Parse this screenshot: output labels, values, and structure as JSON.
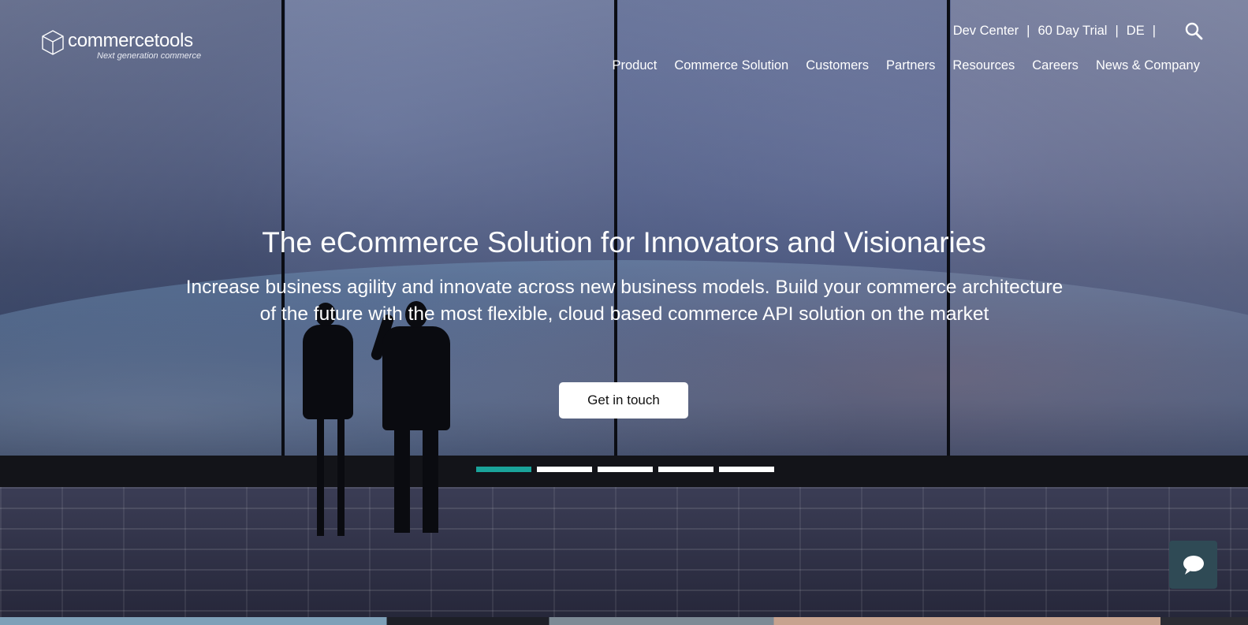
{
  "logo": {
    "name": "commercetools",
    "tagline": "Next generation commerce"
  },
  "utility_nav": {
    "items": [
      "Dev Center",
      "60 Day Trial",
      "DE"
    ],
    "separator": "|",
    "search_icon": "search-icon"
  },
  "main_nav": {
    "items": [
      "Product",
      "Commerce Solution",
      "Customers",
      "Partners",
      "Resources",
      "Careers",
      "News & Company"
    ]
  },
  "hero": {
    "headline": "The eCommerce Solution for Innovators and Visionaries",
    "subhead": "Increase business agility and innovate across new business models. Build your commerce architecture of the future with the most flexible, cloud based commerce API solution on the market",
    "cta_label": "Get in touch",
    "carousel": {
      "slide_count": 5,
      "active_index": 0
    }
  },
  "chat": {
    "icon": "chat-bubble-icon"
  },
  "colors": {
    "accent": "#1aa39a",
    "chat_bg": "#2f4a55",
    "cta_bg": "#ffffff",
    "text": "#ffffff"
  }
}
